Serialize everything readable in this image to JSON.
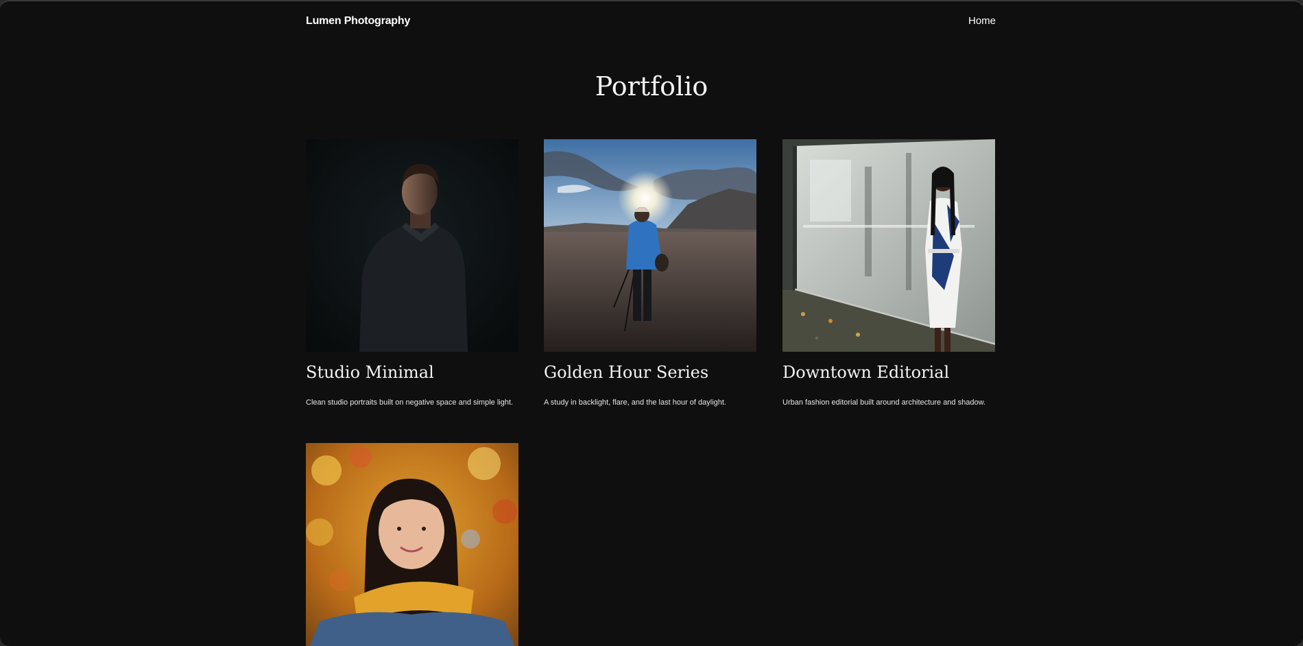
{
  "header": {
    "brand": "Lumen Photography",
    "nav": [
      {
        "label": "Home"
      }
    ]
  },
  "page": {
    "title": "Portfolio"
  },
  "portfolio": [
    {
      "title": "Studio Minimal",
      "description": "Clean studio portraits built on negative space and simple light."
    },
    {
      "title": "Golden Hour Series",
      "description": "A study in backlight, flare, and the last hour of daylight."
    },
    {
      "title": "Downtown Editorial",
      "description": "Urban fashion editorial built around architecture and shadow."
    },
    {
      "title": "",
      "description": ""
    }
  ],
  "colors": {
    "background": "#0f0f0f",
    "text": "#f2f2f2"
  }
}
